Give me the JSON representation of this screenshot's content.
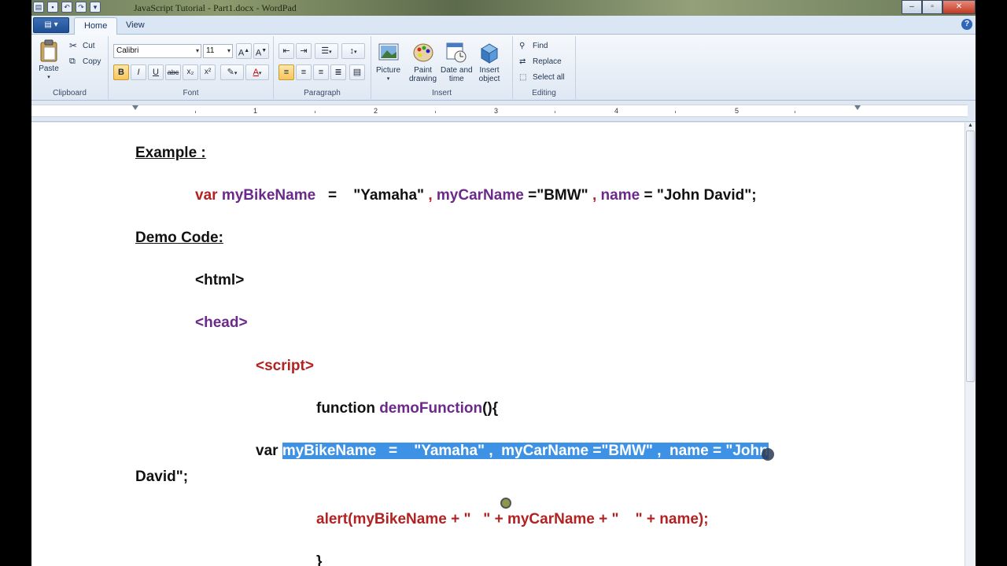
{
  "window": {
    "title": "JavaScript Tutorial - Part1.docx - WordPad"
  },
  "tabs": [
    {
      "label": "Home",
      "active": true
    },
    {
      "label": "View",
      "active": false
    }
  ],
  "ribbon": {
    "clipboard": {
      "label": "Clipboard",
      "paste": "Paste",
      "cut": "Cut",
      "copy": "Copy"
    },
    "font": {
      "label": "Font",
      "family": "Calibri",
      "size": "11"
    },
    "paragraph": {
      "label": "Paragraph"
    },
    "insert": {
      "label": "Insert",
      "picture": "Picture",
      "paint_line1": "Paint",
      "paint_line2": "drawing",
      "date_line1": "Date and",
      "date_line2": "time",
      "object_line1": "Insert",
      "object_line2": "object"
    },
    "editing": {
      "label": "Editing",
      "find": "Find",
      "replace": "Replace",
      "select_all": "Select all"
    }
  },
  "ruler": {
    "numbers": [
      "1",
      "2",
      "3",
      "4",
      "5"
    ]
  },
  "document": {
    "heading_example": "Example :",
    "ex_var": "var",
    "ex_name1": "myBikeName",
    "ex_eq1": "   =    ",
    "ex_val1": "\"Yamaha\"",
    "ex_comma1": " , ",
    "ex_name2": "myCarName",
    "ex_eq2": " =",
    "ex_val2": "\"BMW\"",
    "ex_comma2": " , ",
    "ex_name3": "name",
    "ex_eq3": " = ",
    "ex_val3": "\"John David\";",
    "heading_demo": "Demo Code:",
    "html_tag": "<html>",
    "head_tag": "<head>",
    "script_tag": "<script>",
    "fn_keyword": "function ",
    "fn_name": "demoFunction",
    "fn_paren": "(){",
    "code_var": "var ",
    "code_selected": "myBikeName   =    \"Yamaha\" ,  myCarName =\"BMW\" ,  name = \"John",
    "code_wrap": "David\";",
    "alert_line": "alert(myBikeName + \"   \" + myCarName + \"    \" + name);",
    "brace_close": "}"
  }
}
